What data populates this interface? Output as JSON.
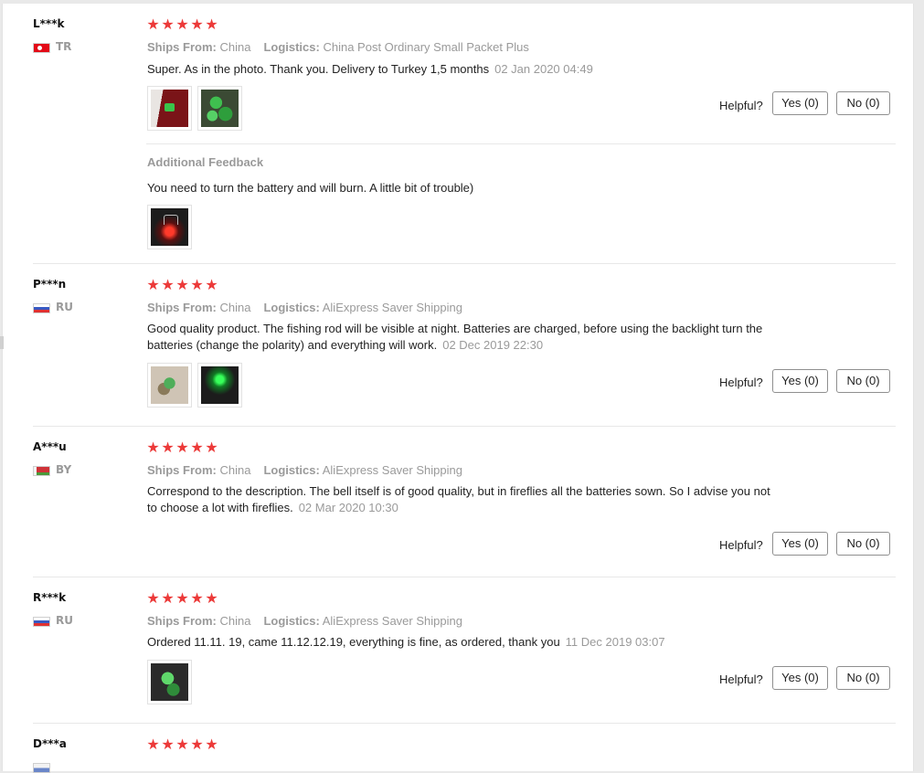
{
  "labels": {
    "ships_from": "Ships From:",
    "logistics": "Logistics:",
    "helpful": "Helpful?",
    "additional_feedback": "Additional Feedback"
  },
  "star_glyph": "★",
  "star_color": "#ec3a39",
  "reviews": [
    {
      "user": "L***k",
      "country": "TR",
      "flag_icon": "turkey-flag-icon",
      "rating": 5,
      "ships_from": "China",
      "logistics": "China Post Ordinary Small Packet Plus",
      "text": "Super. As in the photo. Thank you. Delivery to Turkey 1,5 months",
      "date": "02 Jan 2020 04:49",
      "yes": "Yes (0)",
      "no": "No (0)",
      "additional_text": "You need to turn the battery and will burn. A little bit of trouble)"
    },
    {
      "user": "P***n",
      "country": "RU",
      "flag_icon": "russia-flag-icon",
      "rating": 5,
      "ships_from": "China",
      "logistics": "AliExpress Saver Shipping",
      "text_line1": "Good quality product. The fishing rod will be visible at night. Batteries are charged, before using the backlight turn the",
      "text_line2": "batteries (change the polarity) and everything will work.",
      "date": "02 Dec 2019 22:30",
      "yes": "Yes (0)",
      "no": "No (0)"
    },
    {
      "user": "A***u",
      "country": "BY",
      "flag_icon": "belarus-flag-icon",
      "rating": 5,
      "ships_from": "China",
      "logistics": "AliExpress Saver Shipping",
      "text_line1": "Correspond to the description. The bell itself is of good quality, but in fireflies all the batteries sown. So I advise you not",
      "text_line2": "to choose a lot with fireflies.",
      "date": "02 Mar 2020 10:30",
      "yes": "Yes (0)",
      "no": "No (0)"
    },
    {
      "user": "R***k",
      "country": "RU",
      "flag_icon": "russia-flag-icon",
      "rating": 5,
      "ships_from": "China",
      "logistics": "AliExpress Saver Shipping",
      "text": "Ordered 11.11. 19, came 11.12.12.19, everything is fine, as ordered, thank you",
      "date": "11 Dec 2019 03:07",
      "yes": "Yes (0)",
      "no": "No (0)"
    },
    {
      "user": "D***a",
      "rating": 5
    }
  ]
}
